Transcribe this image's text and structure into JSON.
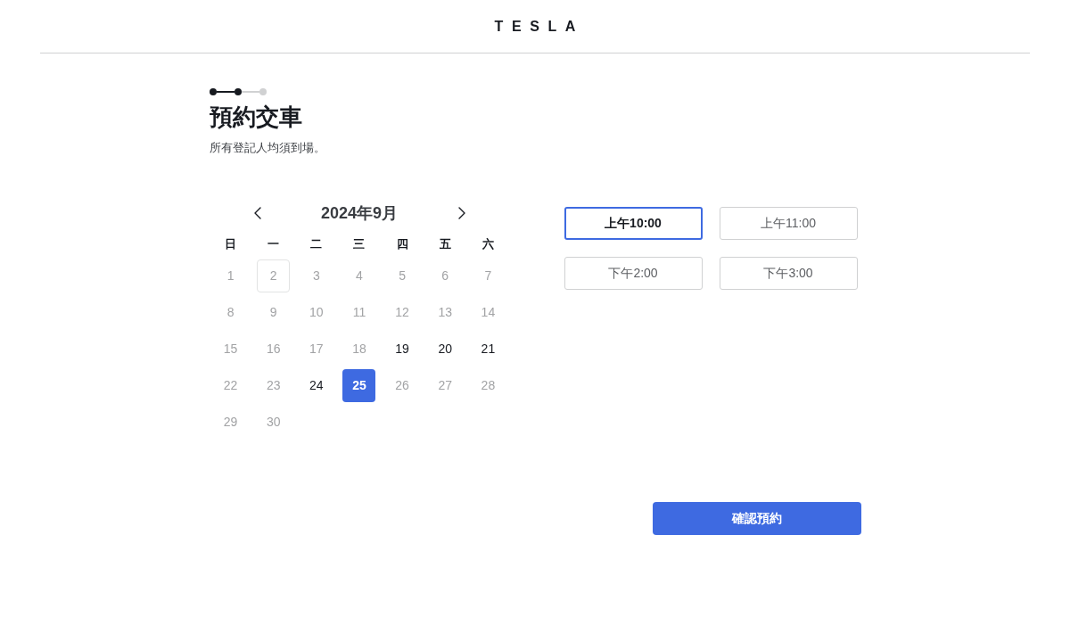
{
  "header": {
    "logo": "TESLA"
  },
  "stepper": [
    {
      "reached": true
    },
    {
      "reached": true
    },
    {
      "reached": false
    }
  ],
  "title": "預約交車",
  "subtitle": "所有登記人均須到場。",
  "calendar": {
    "month": "2024年9月",
    "weekdays": [
      "日",
      "一",
      "二",
      "三",
      "四",
      "五",
      "六"
    ],
    "days": [
      {
        "label": "1",
        "available": false,
        "selected": false,
        "today": false
      },
      {
        "label": "2",
        "available": false,
        "selected": false,
        "today": true
      },
      {
        "label": "3",
        "available": false,
        "selected": false,
        "today": false
      },
      {
        "label": "4",
        "available": false,
        "selected": false,
        "today": false
      },
      {
        "label": "5",
        "available": false,
        "selected": false,
        "today": false
      },
      {
        "label": "6",
        "available": false,
        "selected": false,
        "today": false
      },
      {
        "label": "7",
        "available": false,
        "selected": false,
        "today": false
      },
      {
        "label": "8",
        "available": false,
        "selected": false,
        "today": false
      },
      {
        "label": "9",
        "available": false,
        "selected": false,
        "today": false
      },
      {
        "label": "10",
        "available": false,
        "selected": false,
        "today": false
      },
      {
        "label": "11",
        "available": false,
        "selected": false,
        "today": false
      },
      {
        "label": "12",
        "available": false,
        "selected": false,
        "today": false
      },
      {
        "label": "13",
        "available": false,
        "selected": false,
        "today": false
      },
      {
        "label": "14",
        "available": false,
        "selected": false,
        "today": false
      },
      {
        "label": "15",
        "available": false,
        "selected": false,
        "today": false
      },
      {
        "label": "16",
        "available": false,
        "selected": false,
        "today": false
      },
      {
        "label": "17",
        "available": false,
        "selected": false,
        "today": false
      },
      {
        "label": "18",
        "available": false,
        "selected": false,
        "today": false
      },
      {
        "label": "19",
        "available": true,
        "selected": false,
        "today": false
      },
      {
        "label": "20",
        "available": true,
        "selected": false,
        "today": false
      },
      {
        "label": "21",
        "available": true,
        "selected": false,
        "today": false
      },
      {
        "label": "22",
        "available": false,
        "selected": false,
        "today": false
      },
      {
        "label": "23",
        "available": false,
        "selected": false,
        "today": false
      },
      {
        "label": "24",
        "available": true,
        "selected": false,
        "today": false
      },
      {
        "label": "25",
        "available": true,
        "selected": true,
        "today": false
      },
      {
        "label": "26",
        "available": false,
        "selected": false,
        "today": false
      },
      {
        "label": "27",
        "available": false,
        "selected": false,
        "today": false
      },
      {
        "label": "28",
        "available": false,
        "selected": false,
        "today": false
      },
      {
        "label": "29",
        "available": false,
        "selected": false,
        "today": false
      },
      {
        "label": "30",
        "available": false,
        "selected": false,
        "today": false
      }
    ]
  },
  "time_slots": [
    {
      "label": "上午10:00",
      "selected": true
    },
    {
      "label": "上午11:00",
      "selected": false
    },
    {
      "label": "下午2:00",
      "selected": false
    },
    {
      "label": "下午3:00",
      "selected": false
    }
  ],
  "confirm_button": "確認預約"
}
